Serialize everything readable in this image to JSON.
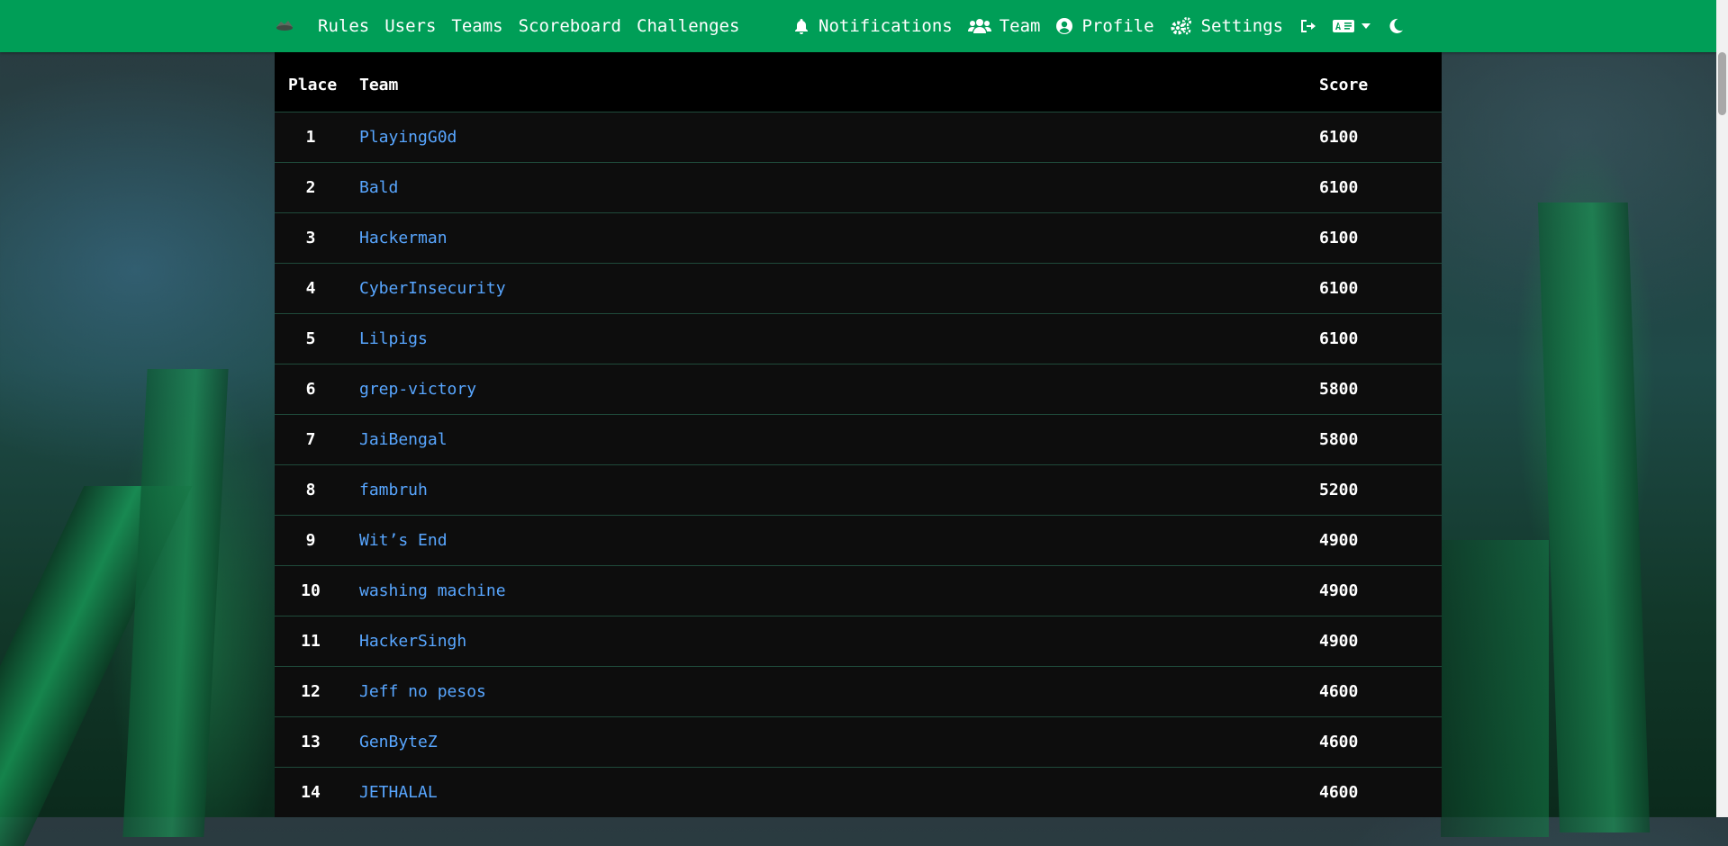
{
  "nav": {
    "brand_icon": "logo-icon",
    "left_links": [
      {
        "label": "Rules"
      },
      {
        "label": "Users"
      },
      {
        "label": "Teams"
      },
      {
        "label": "Scoreboard"
      },
      {
        "label": "Challenges"
      }
    ],
    "right_links": [
      {
        "label": "Notifications",
        "icon": "bell-icon"
      },
      {
        "label": "Team",
        "icon": "users-icon"
      },
      {
        "label": "Profile",
        "icon": "user-circle-icon"
      },
      {
        "label": "Settings",
        "icon": "gears-icon"
      }
    ],
    "logout_icon": "logout-icon",
    "language_icon": "language-icon",
    "dropdown_icon": "caret-down-icon",
    "theme_icon": "moon-icon"
  },
  "colors": {
    "navbar": "#009e57",
    "link": "#58a6ff",
    "table_bg": "#0d0d0d",
    "header_bg": "#000000"
  },
  "scoreboard": {
    "headers": {
      "place": "Place",
      "team": "Team",
      "score": "Score"
    },
    "rows": [
      {
        "place": "1",
        "team": "PlayingG0d",
        "score": "6100"
      },
      {
        "place": "2",
        "team": "Bald",
        "score": "6100"
      },
      {
        "place": "3",
        "team": "Hackerman",
        "score": "6100"
      },
      {
        "place": "4",
        "team": "CyberInsecurity",
        "score": "6100"
      },
      {
        "place": "5",
        "team": "Lilpigs",
        "score": "6100"
      },
      {
        "place": "6",
        "team": "grep-victory",
        "score": "5800"
      },
      {
        "place": "7",
        "team": "JaiBengal",
        "score": "5800"
      },
      {
        "place": "8",
        "team": "fambruh",
        "score": "5200"
      },
      {
        "place": "9",
        "team": "Wit’s End",
        "score": "4900"
      },
      {
        "place": "10",
        "team": "washing machine",
        "score": "4900"
      },
      {
        "place": "11",
        "team": "HackerSingh",
        "score": "4900"
      },
      {
        "place": "12",
        "team": "Jeff no pesos",
        "score": "4600"
      },
      {
        "place": "13",
        "team": "GenByteZ",
        "score": "4600"
      },
      {
        "place": "14",
        "team": "JETHALAL",
        "score": "4600"
      }
    ]
  }
}
